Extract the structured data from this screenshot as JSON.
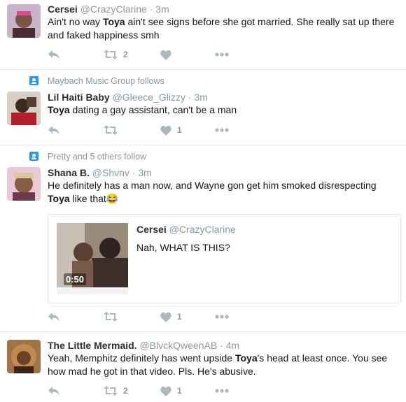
{
  "tweets": [
    {
      "name": "Cersei",
      "handle": "@CrazyClarine",
      "time": "3m",
      "text_parts": [
        "Ain't no way ",
        "Toya",
        " ain't see signs before she got married. She really sat up there and faked happiness smh"
      ],
      "retweets": "2",
      "likes": ""
    },
    {
      "context": "Maybach Music Group follows",
      "name": "Lil Haiti Baby",
      "handle": "@Gleece_Glizzy",
      "time": "3m",
      "text_parts": [
        "Toya",
        " dating a gay assistant, can't be a man"
      ],
      "retweets": "",
      "likes": "1"
    },
    {
      "context": "Pretty and 5 others follow",
      "name": "Shana B.",
      "handle": "@Shvnv",
      "time": "3m",
      "text_line1": "He definitely has a man now, and Wayne gon get him smoked disrespecting",
      "text_bold": "Toya",
      "text_tail": " like that😂",
      "quote": {
        "name": "Cersei",
        "handle": "@CrazyClarine",
        "text": "Nah, WHAT IS THIS?",
        "duration": "0:50"
      },
      "retweets": "",
      "likes": "1"
    },
    {
      "name": "The Little Mermaid.",
      "handle": "@BlvckQweenAB",
      "time": "4m",
      "text_parts": [
        "Yeah, Memphitz definitely has went upside ",
        "Toya",
        "'s head at least once. You see how mad he got in that video. Pls. He's abusive."
      ],
      "retweets": "2",
      "likes": "1"
    }
  ],
  "separator": "·",
  "icons": [
    "reply-icon",
    "retweet-icon",
    "like-icon",
    "more-icon",
    "follow-context-icon",
    "play-icon"
  ],
  "colors": {
    "secondary": "#8899a6",
    "icon": "#aab8c2",
    "border": "#e1e8ed",
    "context_icon": "#2b96e8"
  }
}
